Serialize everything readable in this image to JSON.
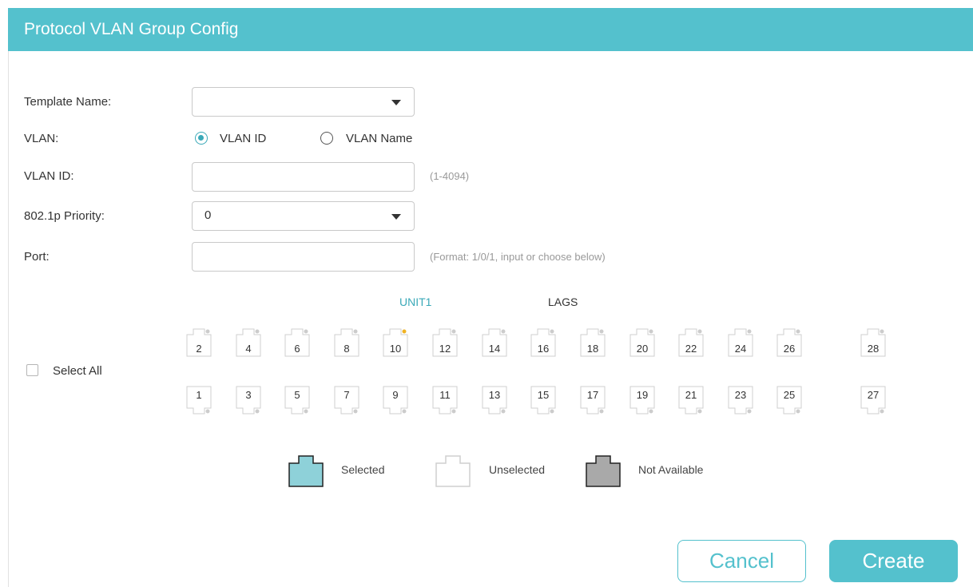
{
  "dialog": {
    "title": "Protocol VLAN Group Config"
  },
  "form": {
    "template_name": {
      "label": "Template Name:",
      "value": ""
    },
    "vlan": {
      "label": "VLAN:",
      "options": [
        "VLAN ID",
        "VLAN Name"
      ],
      "selected": "VLAN ID"
    },
    "vlan_id": {
      "label": "VLAN ID:",
      "value": "",
      "hint": "(1-4094)"
    },
    "priority": {
      "label": "802.1p Priority:",
      "value": "0"
    },
    "port": {
      "label": "Port:",
      "value": "",
      "hint": "(Format: 1/0/1, input or choose below)"
    }
  },
  "port_panel": {
    "tabs": {
      "unit": "UNIT1",
      "lags": "LAGS"
    },
    "active_tab": "UNIT1",
    "select_all_label": "Select All",
    "select_all_checked": false,
    "top_ports": [
      "2",
      "4",
      "6",
      "8",
      "10",
      "12",
      "14",
      "16",
      "18",
      "20",
      "22",
      "24",
      "26",
      "28"
    ],
    "bottom_ports": [
      "1",
      "3",
      "5",
      "7",
      "9",
      "11",
      "13",
      "15",
      "17",
      "19",
      "21",
      "23",
      "25",
      "27"
    ],
    "active_link_port": "10"
  },
  "legend": {
    "selected": "Selected",
    "unselected": "Unselected",
    "not_available": "Not Available"
  },
  "colors": {
    "accent": "#54c1cd",
    "selected_fill": "#8ed1d9",
    "not_available_fill": "#a9a9a9",
    "link_led": "#f0b323",
    "idle_led": "#cccccc"
  },
  "actions": {
    "cancel": "Cancel",
    "create": "Create"
  }
}
